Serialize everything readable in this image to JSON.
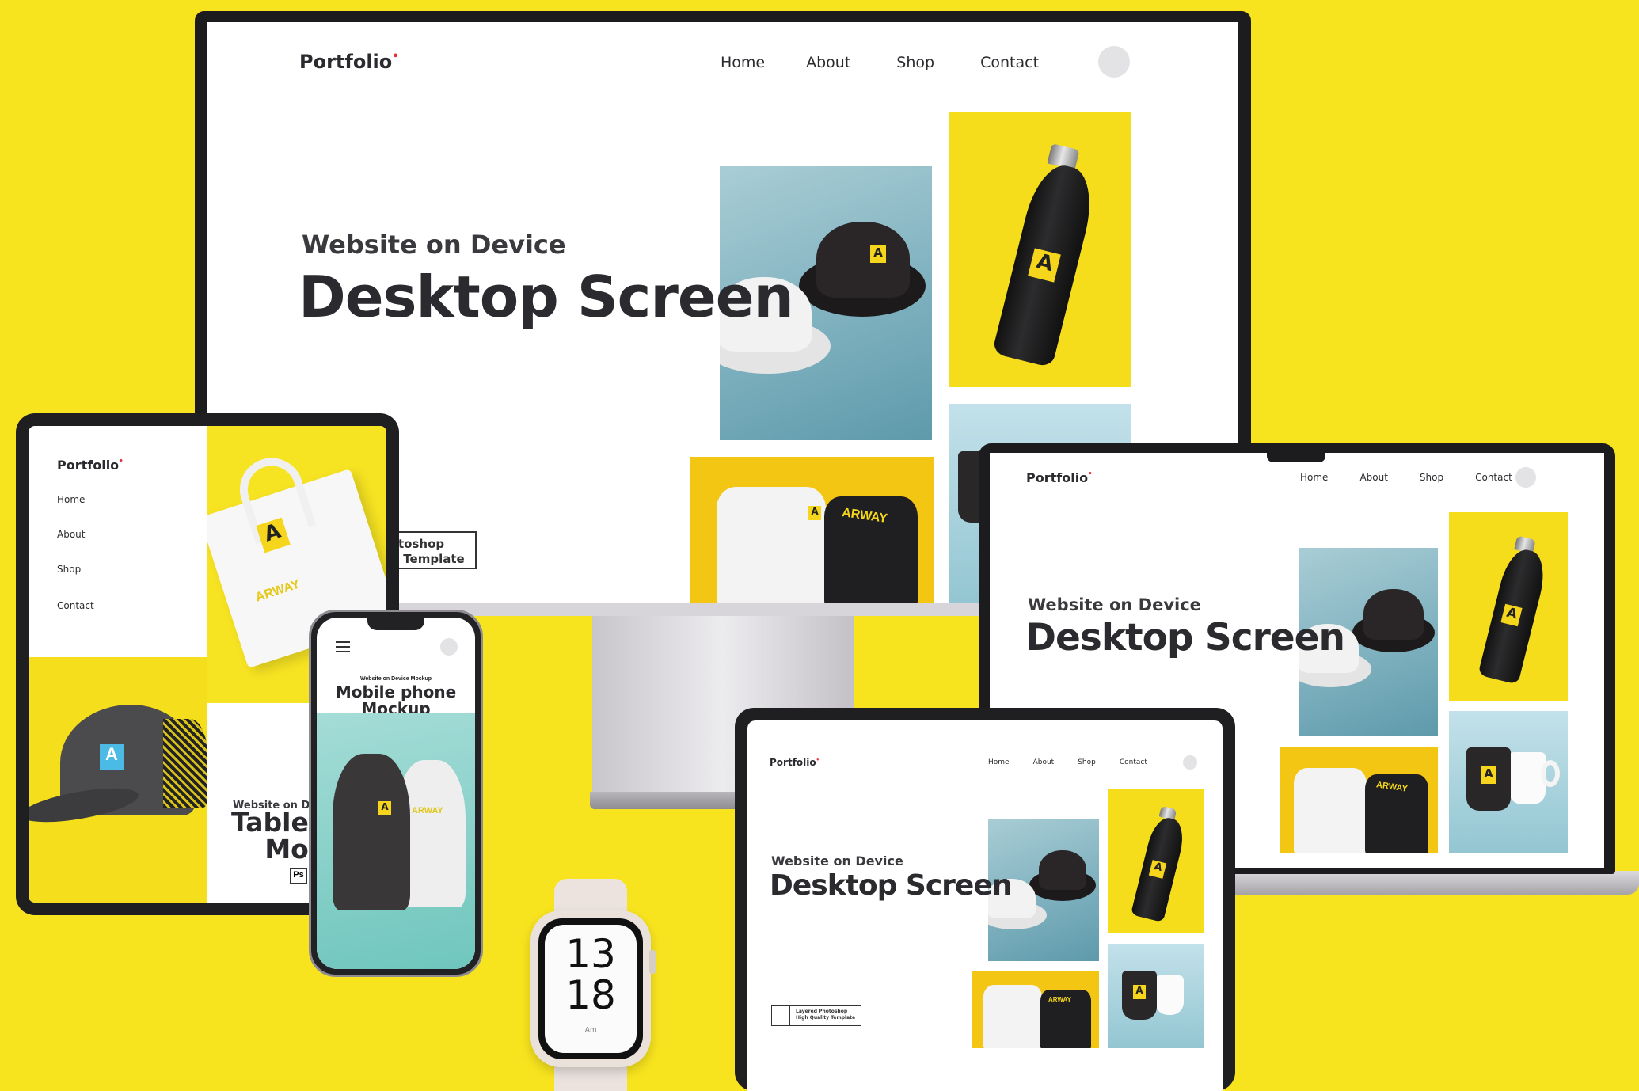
{
  "site": {
    "logo": "Portfolio",
    "logo_dot": "•",
    "nav": [
      "Home",
      "About",
      "Shop",
      "Contact"
    ],
    "subtitle": "Website on Device",
    "headline": "Desktop Screen",
    "template_line1": "Layered Photoshop",
    "template_line2": "High Quality Template",
    "template_line1_cropped": "hotoshop",
    "template_line2_cropped": "ity Template"
  },
  "brand": {
    "mark": "A",
    "wordmark": "ARWAY"
  },
  "tablet_left": {
    "logo": "Portfolio",
    "menu": [
      "Home",
      "About",
      "Shop",
      "Contact"
    ],
    "subtitle": "Website on De",
    "title_line1": "Table",
    "title_line2": "Mo",
    "badge": "Ps"
  },
  "phone": {
    "menu_icon": "hamburger-icon",
    "subtitle": "Website on Device Mockup",
    "title_line1": "Mobile phone",
    "title_line2": "Mockup"
  },
  "watch": {
    "hour": "13",
    "minute": "18",
    "period": "Am"
  },
  "colors": {
    "background": "#f8e41e",
    "text_dark": "#2b2a2e",
    "logo_dot": "#e5323a",
    "tile_yellow": "#f5dd1c",
    "tile_blue": "#7fb1bf",
    "tile_mint": "#6fc6bd",
    "device_frame": "#1c1c1f"
  }
}
